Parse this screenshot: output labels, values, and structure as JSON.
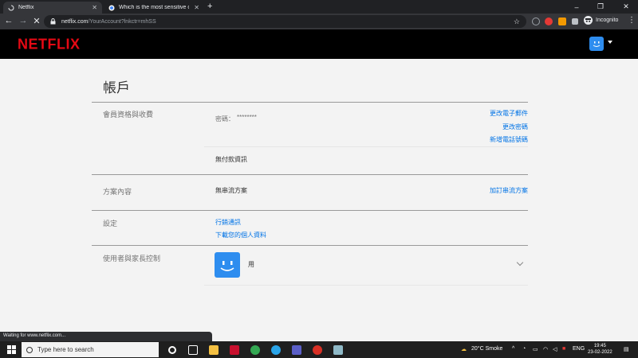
{
  "browser": {
    "tabs": [
      {
        "label": "Netflix",
        "active": true
      },
      {
        "label": "Which is the most sensitive org...",
        "active": false
      }
    ],
    "url": {
      "host": "netflix.com",
      "path": "/YourAccount?lnkctr=mhSS"
    },
    "profile_label": "Incognito",
    "status_text": "Waiting for www.netflix.com..."
  },
  "netflix": {
    "logo": "NETFLIX",
    "page_title": "帳戶",
    "membership": {
      "label": "會員資格與收費",
      "password_label": "密碼：",
      "password_value": "********",
      "change_email": "更改電子郵件",
      "change_password": "更改密碼",
      "add_phone": "新增電話號碼",
      "no_payment": "無付款資訊"
    },
    "plan": {
      "label": "方案內容",
      "value": "無串流方案",
      "subscribe": "加訂串流方案"
    },
    "settings": {
      "label": "設定",
      "marketing": "行銷通訊",
      "download_info": "下載您的個人資料"
    },
    "profiles": {
      "label": "使用者與家長控制",
      "profile_name": "用"
    }
  },
  "taskbar": {
    "search_placeholder": "Type here to search",
    "weather": "20°C  Smoke",
    "lang": "ENG",
    "time": "19:45",
    "date": "23-02-2022"
  },
  "colors": {
    "netflix_red": "#e50914",
    "link_blue": "#0073e6",
    "avatar_blue": "#2e8def"
  }
}
